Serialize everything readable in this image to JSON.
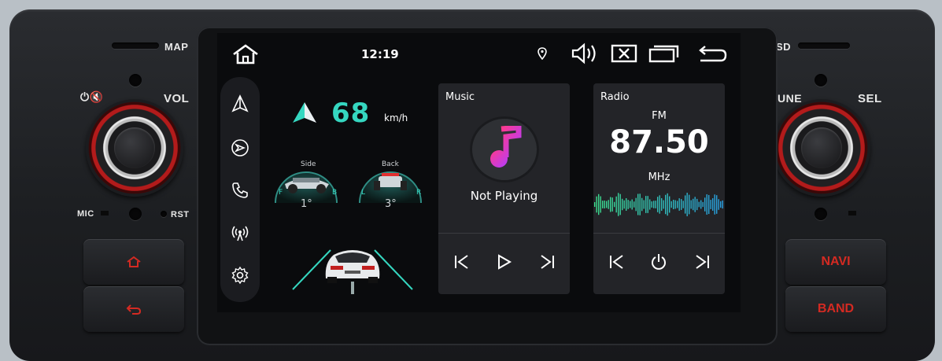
{
  "hardware": {
    "map_label": "MAP",
    "vol_label": "VOL",
    "mic_label": "MIC",
    "rst_label": "RST",
    "sd_label": "SD",
    "tune_label": "TUNE",
    "sel_label": "SEL",
    "navi_label": "NAVI",
    "band_label": "BAND",
    "accent": "#d42a22"
  },
  "status_bar": {
    "time": "12:19",
    "icons": [
      "home-icon",
      "location-icon",
      "volume-icon",
      "close-window-icon",
      "recent-apps-icon",
      "back-icon"
    ]
  },
  "sidebar": {
    "items": [
      "navigation-icon",
      "car-play-icon",
      "phone-icon",
      "radio-signal-icon",
      "settings-icon"
    ]
  },
  "dashboard": {
    "speed": "68",
    "speed_unit": "km/h",
    "gauge_side": {
      "label": "Side",
      "value": "1°",
      "left": "F",
      "right": "B"
    },
    "gauge_back": {
      "label": "Back",
      "value": "3°",
      "left": "L",
      "right": "R"
    },
    "accent": "#35d7c0"
  },
  "music": {
    "title": "Music",
    "status": "Not Playing",
    "controls": [
      "previous-icon",
      "play-icon",
      "next-icon"
    ]
  },
  "radio": {
    "title": "Radio",
    "band": "FM",
    "frequency": "87.50",
    "unit": "MHz",
    "controls": [
      "previous-icon",
      "power-icon",
      "next-icon"
    ]
  }
}
